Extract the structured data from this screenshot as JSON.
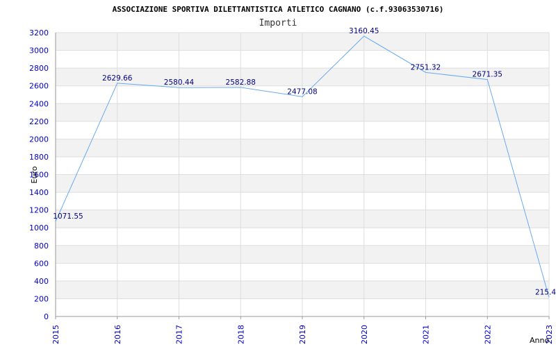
{
  "chart_data": {
    "type": "line",
    "title": "ASSOCIAZIONE SPORTIVA DILETTANTISTICA ATLETICO CAGNANO (c.f.93063530716)",
    "subtitle": "Importi",
    "xlabel": "Anno",
    "ylabel": "Euro",
    "categories": [
      "2015",
      "2016",
      "2017",
      "2018",
      "2019",
      "2020",
      "2021",
      "2022",
      "2023"
    ],
    "values": [
      1071.55,
      2629.66,
      2580.44,
      2582.88,
      2477.08,
      3160.45,
      2751.32,
      2671.35,
      215.4
    ],
    "data_labels": [
      "1071.55",
      "2629.66",
      "2580.44",
      "2582.88",
      "2477.08",
      "3160.45",
      "2751.32",
      "2671.35",
      "215.4"
    ],
    "yticks": [
      "0",
      "200",
      "400",
      "600",
      "800",
      "1000",
      "1200",
      "1400",
      "1600",
      "1800",
      "2000",
      "2200",
      "2400",
      "2600",
      "2800",
      "3000",
      "3200"
    ],
    "ylim": [
      0,
      3200
    ],
    "grid": true,
    "line_color": "#66aaee",
    "tick_color": "#0000cc",
    "label_color": "#000080",
    "band_color": "#f2f2f2"
  }
}
